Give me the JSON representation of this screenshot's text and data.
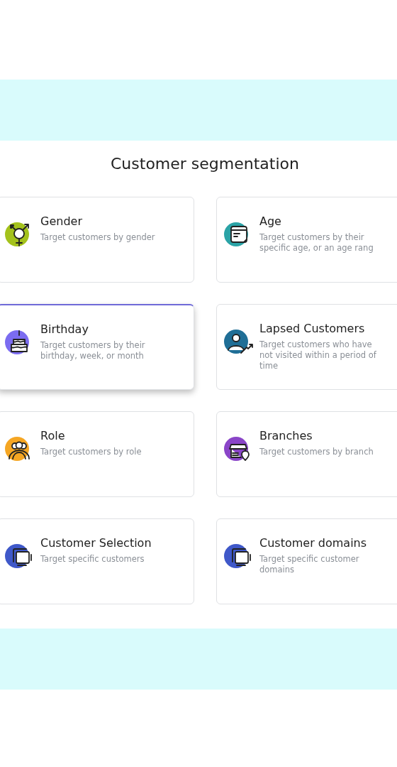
{
  "title": "Customer segmentation",
  "cards": [
    {
      "kind": "gender",
      "color": "#a4c21c",
      "title": "Gender",
      "description": "Target customers by gender",
      "selected": false
    },
    {
      "kind": "calendar",
      "color": "#2aa3a6",
      "title": "Age",
      "description": "Target customers by their specific age, or an age rang",
      "selected": false
    },
    {
      "kind": "cake",
      "color": "#7b6cf0",
      "title": "Birthday",
      "description": "Target customers by their birthday, week, or month",
      "selected": true
    },
    {
      "kind": "person",
      "color": "#1f6e96",
      "title": "Lapsed Customers",
      "description": "Target customers who have not visited within a period of time",
      "selected": false
    },
    {
      "kind": "people",
      "color": "#f5a623",
      "title": "Role",
      "description": "Target customers by role",
      "selected": false
    },
    {
      "kind": "store",
      "color": "#8a45c8",
      "title": "Branches",
      "description": "Target customers by branch",
      "selected": false
    },
    {
      "kind": "windows",
      "color": "#3f58c9",
      "title": "Customer Selection",
      "description": "Target specific customers",
      "selected": false
    },
    {
      "kind": "windows",
      "color": "#3f58c9",
      "title": "Customer domains",
      "description": "Target specific customer domains",
      "selected": false
    }
  ]
}
